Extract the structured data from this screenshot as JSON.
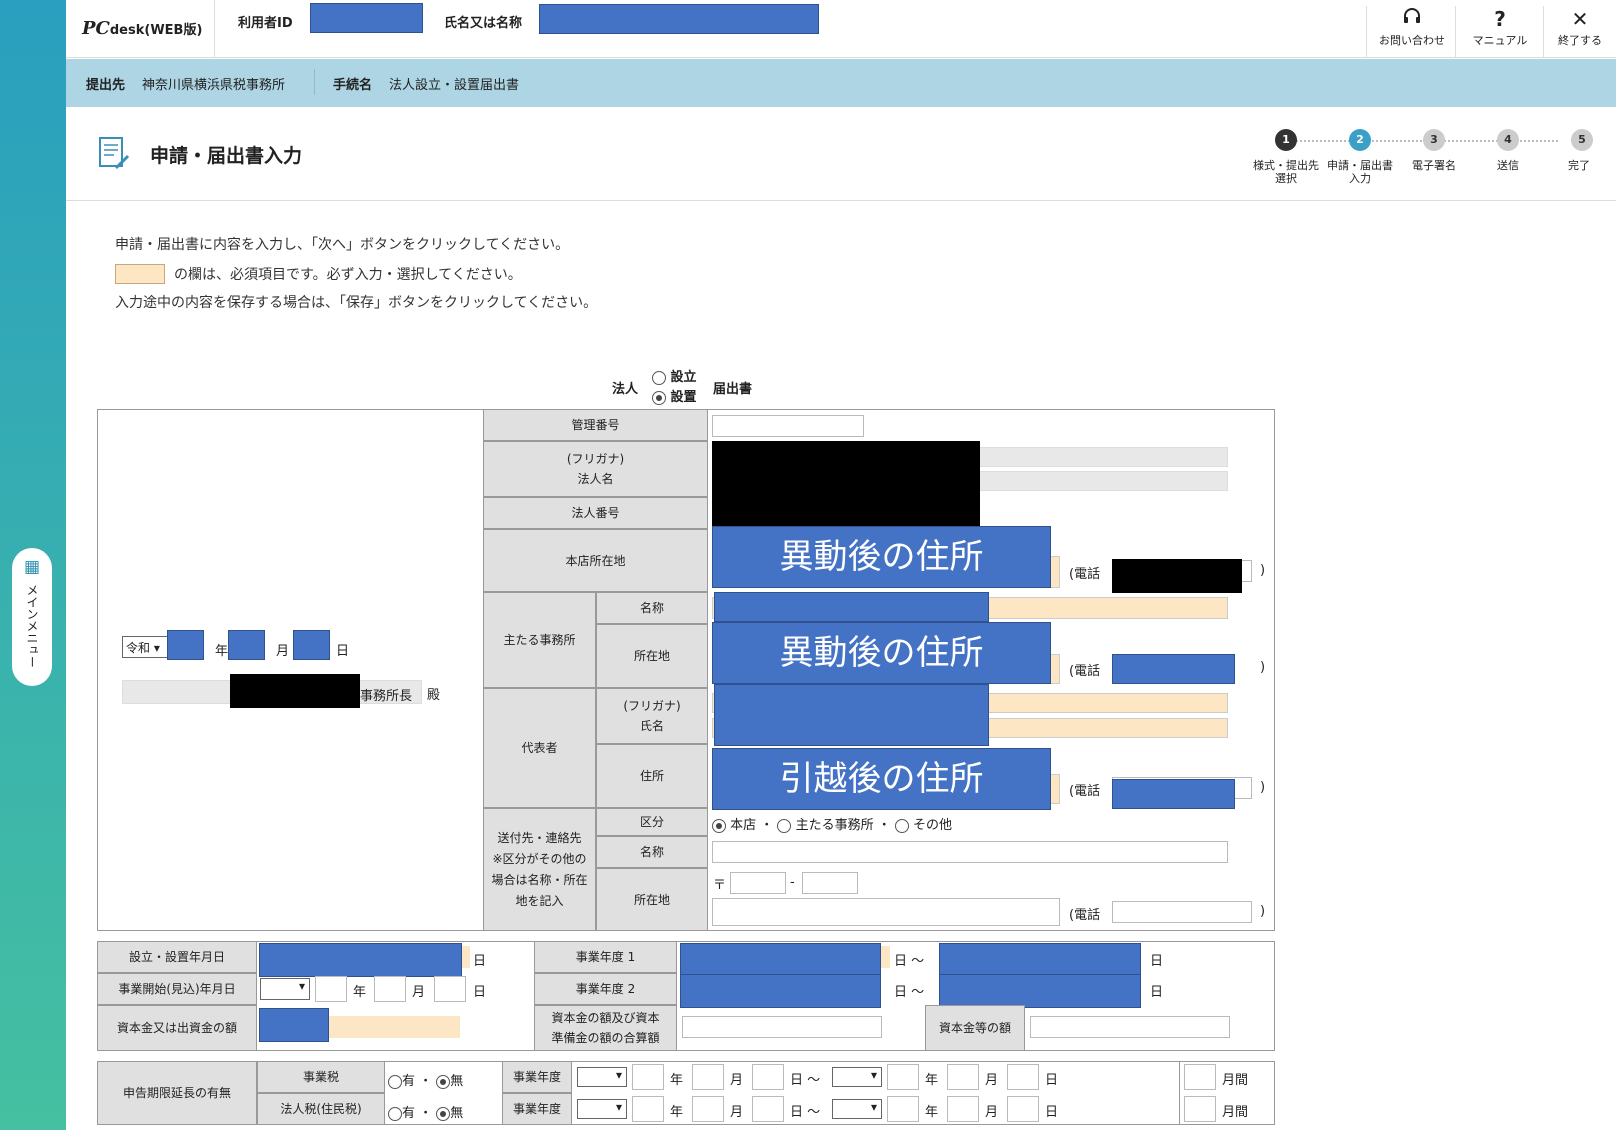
{
  "app": {
    "logo_main": "PC",
    "logo_sub": "desk",
    "logo_tag": "(WEB版)"
  },
  "header": {
    "user_id_label": "利用者ID",
    "name_label": "氏名又は名称",
    "buttons": [
      {
        "icon": "headset-icon",
        "glyph": "🎧",
        "label": "お問い合わせ"
      },
      {
        "icon": "help-icon",
        "glyph": "?",
        "label": "マニュアル"
      },
      {
        "icon": "close-icon",
        "glyph": "✕",
        "label": "終了する"
      }
    ]
  },
  "breadcrumb": {
    "dest_label": "提出先",
    "dest_value": "神奈川県横浜県税事務所",
    "proc_label": "手続名",
    "proc_value": "法人設立・設置届出書"
  },
  "page_title": "申請・届出書入力",
  "steps": [
    {
      "num": "1",
      "label": "様式・提出先\n選択",
      "state": "done"
    },
    {
      "num": "2",
      "label": "申請・届出書\n入力",
      "state": "current"
    },
    {
      "num": "3",
      "label": "電子署名",
      "state": "todo"
    },
    {
      "num": "4",
      "label": "送信",
      "state": "todo"
    },
    {
      "num": "5",
      "label": "完了",
      "state": "todo"
    }
  ],
  "instructions": {
    "line1": "申請・届出書に内容を入力し、「次へ」ボタンをクリックしてください。",
    "line2": "の欄は、必須項目です。必ず入力・選択してください。",
    "line3": "入力途中の内容を保存する場合は、「保存」ボタンをクリックしてください。"
  },
  "form_title": {
    "prefix": "法人",
    "opt1": "設立",
    "opt2": "設置",
    "suffix": "届出書"
  },
  "date_block": {
    "era": "令和",
    "year": "年",
    "month": "月",
    "day": "日",
    "office_suffix": "事務所長",
    "dono": "殿"
  },
  "labels": {
    "kanri": "管理番号",
    "furigana": "(フリガナ)",
    "houjinmei": "法人名",
    "houjin_no": "法人番号",
    "honten": "本店所在地",
    "main_office": "主たる事務所",
    "meisho": "名称",
    "shozaichi": "所在地",
    "daihyo": "代表者",
    "shimei": "氏名",
    "jusho": "住所",
    "send_to": "送付先・連絡先\n※区分がその他の\n場合は名称・所在\n地を記入",
    "kubun": "区分",
    "denwa": "(電話",
    "close_paren": ")",
    "postal": "〒",
    "dash": "-"
  },
  "overlays": {
    "after_move": "異動後の住所",
    "after_move2": "異動後の住所",
    "after_moving": "引越後の住所"
  },
  "kubun_options": [
    "本店",
    "主たる事務所",
    "その他"
  ],
  "kubun_sep": "・",
  "lower": {
    "setsuritsu": "設立・設置年月日",
    "jigyo_kaishi": "事業開始(見込)年月日",
    "shihon": "資本金又は出資金の額",
    "nendo1": "事業年度 1",
    "nendo2": "事業年度 2",
    "shihon_gokei": "資本金の額及び資本\n準備金の額の合算額",
    "shihonkin_to": "資本金等の額",
    "day": "日",
    "kara": "日 〜",
    "year": "年",
    "month": "月"
  },
  "extension": {
    "title": "申告期限延長の有無",
    "rows": [
      {
        "tax": "事業税",
        "yes": "有",
        "no": "無",
        "nendo": "事業年度",
        "months": "月間"
      },
      {
        "tax": "法人税(住民税)",
        "yes": "有",
        "no": "無",
        "nendo": "事業年度",
        "months": "月間"
      }
    ],
    "year": "年",
    "month": "月",
    "kara": "日 〜",
    "day": "日"
  },
  "side_menu": {
    "label": "メインメニュー"
  }
}
